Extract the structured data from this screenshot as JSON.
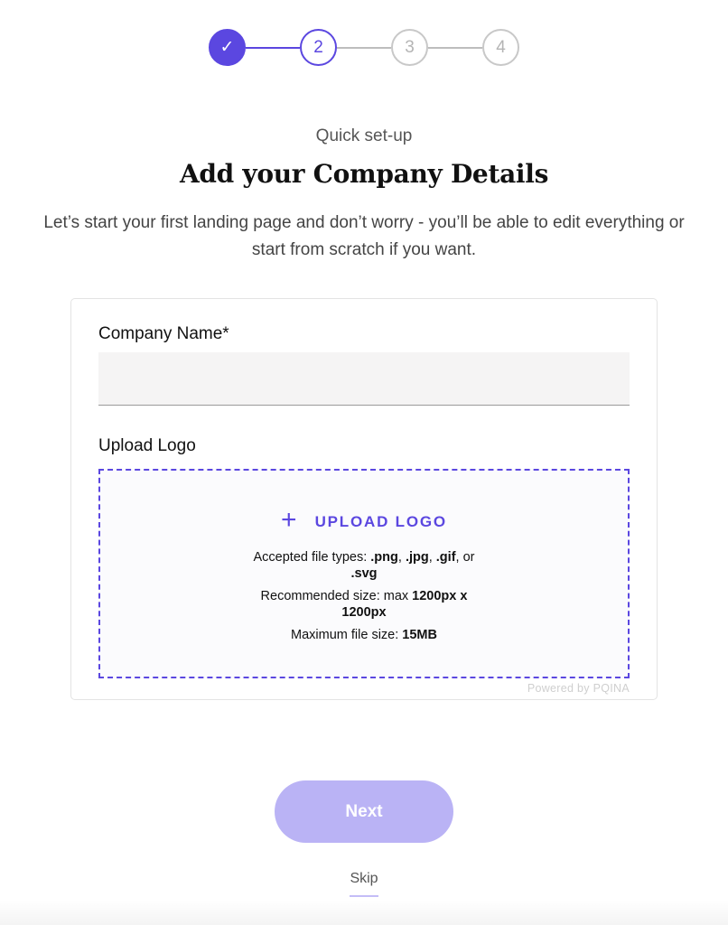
{
  "stepper": {
    "steps": [
      {
        "label": "✓",
        "state": "done"
      },
      {
        "label": "2",
        "state": "active"
      },
      {
        "label": "3",
        "state": "todo"
      },
      {
        "label": "4",
        "state": "todo"
      }
    ]
  },
  "header": {
    "eyebrow": "Quick set-up",
    "title": "Add your Company Details",
    "subtitle": "Let’s start your first landing page and don’t worry - you’ll be able to edit everything or start from scratch if you want."
  },
  "form": {
    "company_name": {
      "label": "Company Name*",
      "value": "",
      "placeholder": ""
    },
    "logo": {
      "label": "Upload Logo",
      "button_label": "UPLOAD LOGO",
      "accepted_prefix": "Accepted file types: ",
      "accepted_types": [
        ".png",
        ".jpg",
        ".gif",
        ".svg"
      ],
      "accepted_or": "or",
      "size_prefix": "Recommended size: max ",
      "size_value": "1200px x 1200px",
      "max_prefix": "Maximum file size: ",
      "max_value": "15MB",
      "powered_by": "Powered by PQINA"
    }
  },
  "actions": {
    "next_label": "Next",
    "skip_label": "Skip"
  },
  "colors": {
    "accent": "#5b47e0",
    "accent_light": "#bab3f5",
    "input_bg": "#f5f4f4"
  }
}
